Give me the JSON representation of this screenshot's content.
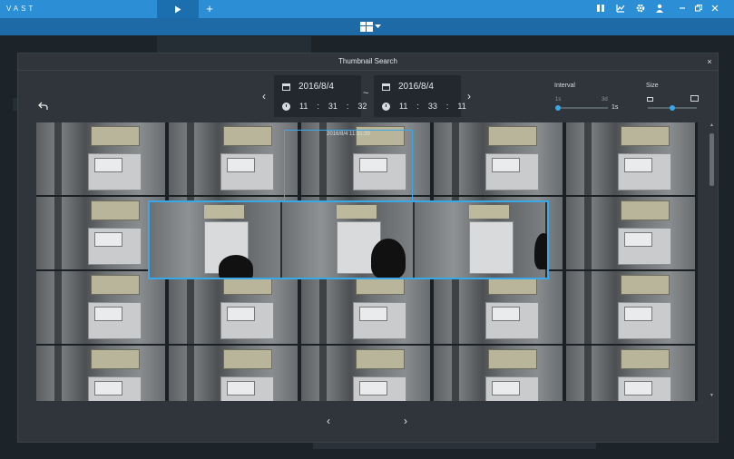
{
  "app": {
    "title": "VAST"
  },
  "tabs": {
    "add_label": "+"
  },
  "icons": {
    "play": "play-icon",
    "add": "plus-icon",
    "layout": "layout-grid-icon",
    "back": "undo-icon",
    "close": "close-icon",
    "calendar": "calendar-icon",
    "clock": "clock-icon"
  },
  "modal": {
    "title": "Thumbnail Search",
    "close_label": "×",
    "start": {
      "date": "2016/8/4",
      "hh": "11",
      "mm": "31",
      "ss": "32"
    },
    "end": {
      "date": "2016/8/4",
      "hh": "11",
      "mm": "33",
      "ss": "11"
    },
    "range_separator": "~",
    "interval": {
      "label": "Interval",
      "min_label": "1s",
      "max_label": "3d",
      "value_label": "1s",
      "level": 0.0
    },
    "size": {
      "label": "Size",
      "level": 0.5
    },
    "selected_timestamp": "2016/8/4 11:31:39",
    "prev_page": "‹",
    "next_page": "›",
    "prev_range": "‹",
    "next_range": "›"
  },
  "colors": {
    "accent": "#3aa7e8",
    "topbar": "#2c8fd6",
    "subbar": "#1e6aa6",
    "panel": "#2f353b"
  }
}
